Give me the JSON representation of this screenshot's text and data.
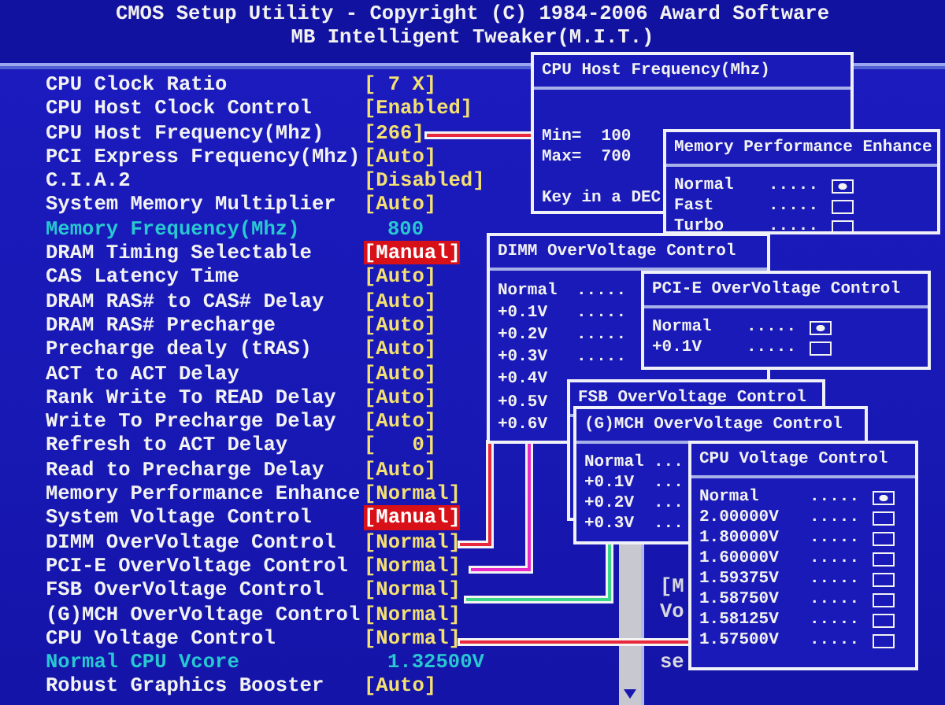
{
  "title": "CMOS Setup Utility - Copyright (C) 1984-2006 Award Software",
  "subtitle": "MB Intelligent Tweaker(M.I.T.)",
  "settings": [
    {
      "label": "CPU Clock Ratio",
      "value": "[ 7 X]",
      "kind": "option",
      "highlighted": false
    },
    {
      "label": "CPU Host Clock Control",
      "value": "[Enabled]",
      "kind": "option",
      "highlighted": false
    },
    {
      "label": "CPU Host Frequency(Mhz)",
      "value": "[266]",
      "kind": "option",
      "highlighted": false
    },
    {
      "label": "PCI Express Frequency(Mhz)",
      "value": "[Auto]",
      "kind": "option",
      "highlighted": false
    },
    {
      "label": "C.I.A.2",
      "value": "[Disabled]",
      "kind": "option",
      "highlighted": false
    },
    {
      "label": "System Memory Multiplier",
      "value": "[Auto]",
      "kind": "option",
      "highlighted": false
    },
    {
      "label": "Memory Frequency(Mhz)",
      "value": "800",
      "kind": "info",
      "highlighted": false
    },
    {
      "label": "DRAM Timing Selectable",
      "value": "[Manual]",
      "kind": "option",
      "highlighted": true
    },
    {
      "label": "CAS Latency Time",
      "value": "[Auto]",
      "kind": "option",
      "highlighted": false
    },
    {
      "label": "DRAM RAS# to CAS# Delay",
      "value": "[Auto]",
      "kind": "option",
      "highlighted": false
    },
    {
      "label": "DRAM RAS# Precharge",
      "value": "[Auto]",
      "kind": "option",
      "highlighted": false
    },
    {
      "label": "Precharge dealy (tRAS)",
      "value": "[Auto]",
      "kind": "option",
      "highlighted": false
    },
    {
      "label": "ACT to ACT Delay",
      "value": "[Auto]",
      "kind": "option",
      "highlighted": false
    },
    {
      "label": "Rank Write To READ Delay",
      "value": "[Auto]",
      "kind": "option",
      "highlighted": false
    },
    {
      "label": "Write To Precharge Delay",
      "value": "[Auto]",
      "kind": "option",
      "highlighted": false
    },
    {
      "label": "Refresh to ACT Delay",
      "value": "[   0]",
      "kind": "option",
      "highlighted": false
    },
    {
      "label": "Read to Precharge Delay",
      "value": "[Auto]",
      "kind": "option",
      "highlighted": false
    },
    {
      "label": "Memory Performance Enhance",
      "value": "[Normal]",
      "kind": "option",
      "highlighted": false
    },
    {
      "label": "System Voltage Control",
      "value": "[Manual]",
      "kind": "option",
      "highlighted": true
    },
    {
      "label": "DIMM OverVoltage Control",
      "value": "[Normal]",
      "kind": "option",
      "highlighted": false
    },
    {
      "label": "PCI-E OverVoltage Control",
      "value": "[Normal]",
      "kind": "option",
      "highlighted": false
    },
    {
      "label": "FSB OverVoltage Control",
      "value": "[Normal]",
      "kind": "option",
      "highlighted": false
    },
    {
      "label": "(G)MCH OverVoltage Control",
      "value": "[Normal]",
      "kind": "option",
      "highlighted": false
    },
    {
      "label": "CPU Voltage Control",
      "value": "[Normal]",
      "kind": "option",
      "highlighted": false
    },
    {
      "label": "Normal CPU Vcore",
      "value": "1.32500V",
      "kind": "info",
      "highlighted": false
    },
    {
      "label": "Robust Graphics Booster",
      "value": "[Auto]",
      "kind": "option",
      "highlighted": false
    }
  ],
  "help_panel": {
    "lines": [
      "[M",
      "Vo",
      "se"
    ]
  },
  "popups": [
    {
      "title": "CPU Host Frequency(Mhz)",
      "color": "#e8283c",
      "lines": [
        "Min=  100",
        "Max=  700",
        "Key in a DEC"
      ]
    },
    {
      "title": "Memory Performance Enhance",
      "options": [
        {
          "label": "Normal",
          "leader": ".....",
          "selected": true
        },
        {
          "label": "Fast",
          "leader": ".....",
          "selected": false
        },
        {
          "label": "Turbo",
          "leader": ".....",
          "selected": false
        }
      ]
    },
    {
      "title": "DIMM OverVoltage Control",
      "color": "#e8283c",
      "options": [
        {
          "label": "Normal",
          "leader": "....."
        },
        {
          "label": "+0.1V",
          "leader": "....."
        },
        {
          "label": "+0.2V",
          "leader": "....."
        },
        {
          "label": "+0.3V",
          "leader": "....."
        },
        {
          "label": "+0.4V"
        },
        {
          "label": "+0.5V"
        },
        {
          "label": "+0.6V"
        }
      ]
    },
    {
      "title": "PCI-E OverVoltage Control",
      "color": "#e828c8",
      "options": [
        {
          "label": "Normal",
          "leader": ".....",
          "selected": true
        },
        {
          "label": "+0.1V",
          "leader": ".....",
          "selected": false
        }
      ]
    },
    {
      "title": "FSB OverVoltage Control",
      "color": "#38d888"
    },
    {
      "title": "(G)MCH OverVoltage Control",
      "options": [
        {
          "label": "Normal",
          "leader": "..."
        },
        {
          "label": "+0.1V",
          "leader": "..."
        },
        {
          "label": "+0.2V",
          "leader": "..."
        },
        {
          "label": "+0.3V",
          "leader": "..."
        }
      ]
    },
    {
      "title": "CPU Voltage Control",
      "color": "#e8283c",
      "options": [
        {
          "label": "Normal",
          "leader": ".....",
          "selected": true
        },
        {
          "label": "2.00000V",
          "leader": ".....",
          "selected": false
        },
        {
          "label": "1.80000V",
          "leader": ".....",
          "selected": false
        },
        {
          "label": "1.60000V",
          "leader": ".....",
          "selected": false
        },
        {
          "label": "1.59375V",
          "leader": ".....",
          "selected": false
        },
        {
          "label": "1.58750V",
          "leader": ".....",
          "selected": false
        },
        {
          "label": "1.58125V",
          "leader": ".....",
          "selected": false
        },
        {
          "label": "1.57500V",
          "leader": ".....",
          "selected": false
        }
      ]
    }
  ]
}
